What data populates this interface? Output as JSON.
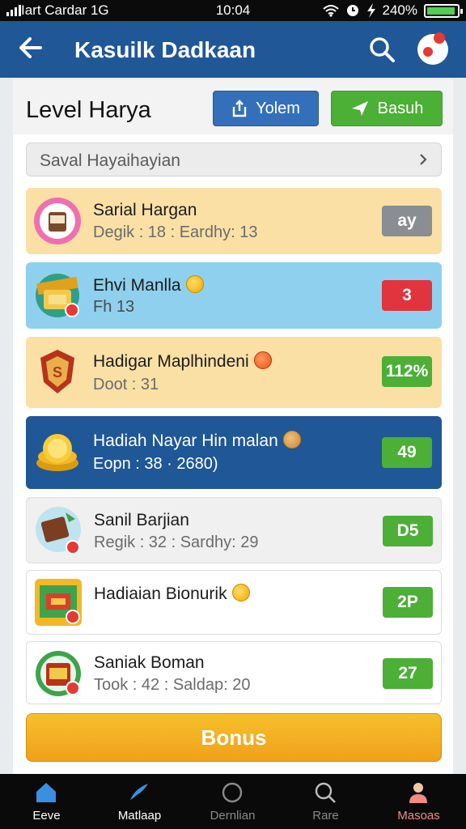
{
  "status_bar": {
    "carrier": "Iart Cardar  1G",
    "time": "10:04",
    "battery_text": "240%",
    "battery_fill": 0.95
  },
  "app_bar": {
    "title": "Kasuilk Dadkaan"
  },
  "panel": {
    "heading": "Level Harya",
    "btn_primary": "Yolem",
    "btn_secondary": "Basuh",
    "search_placeholder": "Saval Hayaihayian"
  },
  "rows": [
    {
      "name": "Sarial Hargan",
      "sub": "Degik : 18 : Eardhy: 13",
      "badge": "ay",
      "bg": "#fbe0a6",
      "badge_color": "#8a8d91",
      "icon": "cup-icon"
    },
    {
      "name": "Ehvi Manlla",
      "sub": "Fh 13",
      "badge": "3",
      "bg": "#8fd0ee",
      "badge_color": "#e0343f",
      "icon": "treasure-icon"
    },
    {
      "name": "Hadigar Maplhindeni",
      "sub": "Doot : 31",
      "badge": "112%",
      "bg": "#fbe0a6",
      "badge_color": "#4caf36",
      "icon": "shield-icon"
    },
    {
      "name": "Hadiah Nayar Hin malan",
      "sub": "Eopn : 38 · 2680)",
      "badge": "49",
      "bg": "#1f5797",
      "badge_color": "#4caf36",
      "icon": "coins-icon"
    },
    {
      "name": "Sanil Barjian",
      "sub": "Regik : 32 : Sardhy: 29",
      "badge": "D5",
      "bg": "#f0f0f0",
      "badge_color": "#4caf36",
      "icon": "chocolate-icon"
    },
    {
      "name": "Hadiaian Bionurik",
      "sub": "",
      "badge": "2P",
      "bg": "#ffffff",
      "badge_color": "#4caf36",
      "icon": "gift-icon"
    },
    {
      "name": "Saniak Boman",
      "sub": "Took : 42 : Saldap: 20",
      "badge": "27",
      "bg": "#ffffff",
      "badge_color": "#4caf36",
      "icon": "house-icon"
    }
  ],
  "bonus_label": "Bonus",
  "tabs": [
    {
      "label": "Eeve",
      "icon": "home-icon"
    },
    {
      "label": "Matlaap",
      "icon": "bird-icon"
    },
    {
      "label": "Dernlian",
      "icon": "circle-icon"
    },
    {
      "label": "Rare",
      "icon": "search-icon"
    },
    {
      "label": "Masoas",
      "icon": "person-icon"
    }
  ],
  "colors": {
    "app_bar": "#1f5797",
    "accent_green": "#4caf36",
    "accent_blue": "#3470b9",
    "bonus": "#f0a01a",
    "tab_active_red": "#f28b82"
  }
}
